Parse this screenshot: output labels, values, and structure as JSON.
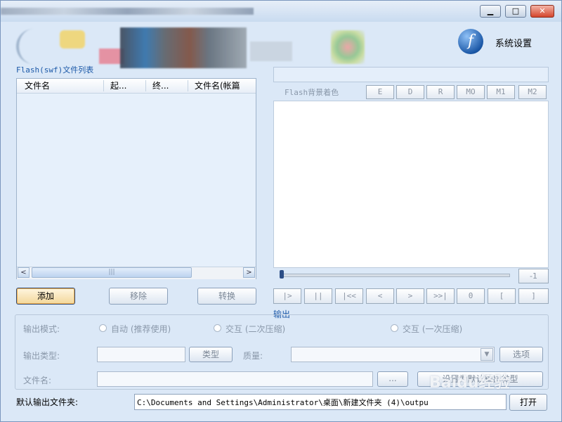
{
  "window": {
    "min": "▁",
    "max": "□",
    "close": "✕"
  },
  "settings": {
    "icon": "f",
    "label": "系统设置"
  },
  "file_list": {
    "title": "Flash(swf)文件列表",
    "columns": [
      "文件名",
      "起...",
      "终...",
      "文件名(帐篇"
    ],
    "scroll_thumb": "|||",
    "left_arrow": "<",
    "right_arrow": ">"
  },
  "buttons": {
    "add": "添加",
    "remove": "移除",
    "convert": "转换",
    "browse": "...",
    "set_output_type": "设置为默认输出类型",
    "options": "选项",
    "type": "类型",
    "open": "打开"
  },
  "flash": {
    "bg_color_label": "Flash背景着色",
    "color_buttons": [
      "E",
      "D",
      "R",
      "MO",
      "M1",
      "M2"
    ],
    "position_value": "-1",
    "controls": [
      "|>",
      "||",
      "|<<",
      "<",
      ">",
      ">>|",
      "0",
      "[",
      "]"
    ]
  },
  "output": {
    "section_title": "输出",
    "mode_label": "输出模式:",
    "modes": [
      "自动 (推荐使用)",
      "交互 (二次压缩)",
      "交互 (一次压缩)"
    ],
    "type_label": "输出类型:",
    "quality_label": "质量:",
    "filename_label": "文件名:",
    "default_folder_label": "默认输出文件夹:",
    "default_folder_path": "C:\\Documents and Settings\\Administrator\\桌面\\新建文件夹 (4)\\outpu"
  },
  "watermark": "Baidu经验",
  "colors": {
    "accent": "#1c59a8",
    "panel": "#e6f0fb"
  }
}
